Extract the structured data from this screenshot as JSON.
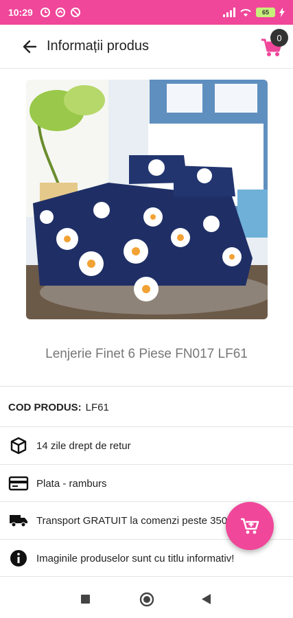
{
  "status_bar": {
    "time": "10:29",
    "battery": "65"
  },
  "app_bar": {
    "title": "Informații produs",
    "cart_count": "0"
  },
  "product": {
    "name": "Lenjerie Finet 6 Piese FN017 LF61",
    "code_label": "COD PRODUS:",
    "code_value": "LF61"
  },
  "info_rows": {
    "return": "14 zile drept de retur",
    "payment": "Plata - ramburs",
    "transport": "Transport GRATUIT la comenzi peste 350 lei!",
    "disclaimer": "Imaginile produselor sunt cu titlu informativ!"
  },
  "colors": {
    "accent": "#f0479a",
    "text": "#222222",
    "muted": "#777777"
  },
  "icons": {
    "back": "arrow-left-icon",
    "cart": "cart-icon",
    "return": "box-icon",
    "payment": "credit-card-icon",
    "transport": "truck-icon",
    "disclaimer": "info-icon",
    "fab": "add-to-cart-icon"
  }
}
